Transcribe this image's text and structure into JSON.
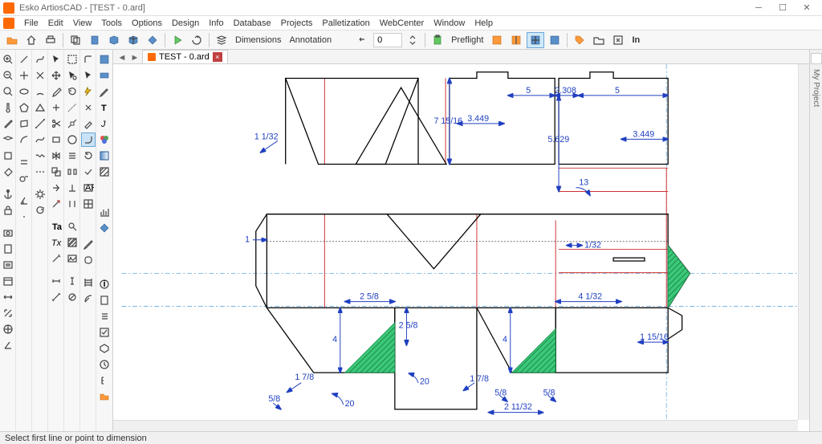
{
  "window": {
    "app_name": "Esko ArtiosCAD",
    "document": "[TEST - 0.ard]",
    "title": "Esko ArtiosCAD - [TEST - 0.ard]"
  },
  "menubar": [
    "File",
    "Edit",
    "View",
    "Tools",
    "Options",
    "Design",
    "Info",
    "Database",
    "Projects",
    "Palletization",
    "WebCenter",
    "Window",
    "Help"
  ],
  "toolbar": {
    "dimensions_label": "Dimensions",
    "annotation_label": "Annotation",
    "spin_value": "0",
    "preflight_label": "Preflight",
    "in_label": "In"
  },
  "tab": {
    "name": "TEST - 0.ard"
  },
  "right_panel": {
    "label": "My Project"
  },
  "statusbar": {
    "prompt": "Select first line or point to dimension"
  },
  "drawing": {
    "dimensions": {
      "d1": "1 1/32",
      "d2": "7 15/16",
      "d3": "3.449",
      "d4": "5",
      "d5": "2.308",
      "d6": "5",
      "d7": "3.449",
      "d8": "5.629",
      "d9": "13",
      "d10": "1/32",
      "d11": "1",
      "d12": "2 5/8",
      "d13": "4 1/32",
      "d14": "1 15/16",
      "d15": "4",
      "d16": "2 5/8",
      "d17": "4",
      "d18": "1 7/8",
      "d19": "20",
      "d20": "20",
      "d21": "5/8",
      "d22": "1 7/8",
      "d23": "5/8",
      "d24": "5/8",
      "d25": "2 11/32"
    }
  }
}
